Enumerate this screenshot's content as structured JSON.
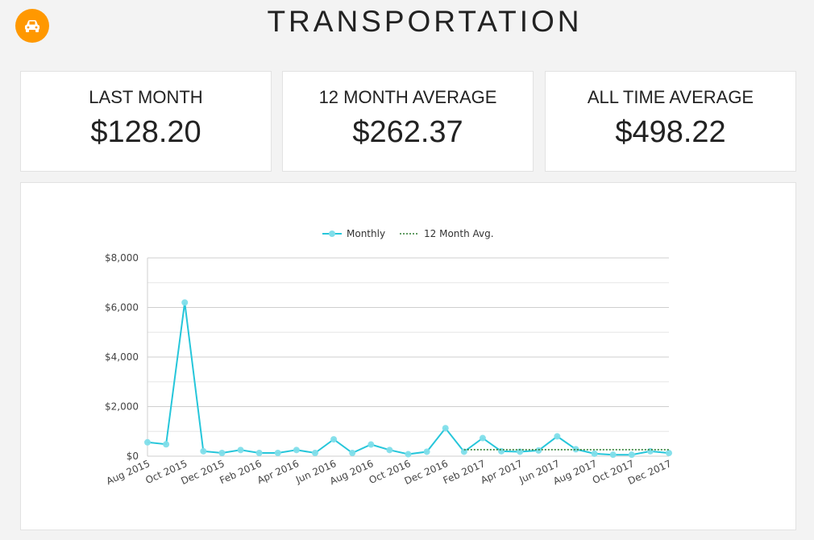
{
  "header": {
    "title": "TRANSPORTATION",
    "icon": "car-icon",
    "icon_color": "#ff9800"
  },
  "stats": [
    {
      "label": "LAST MONTH",
      "value": "$128.20"
    },
    {
      "label": "12 MONTH AVERAGE",
      "value": "$262.37"
    },
    {
      "label": "ALL TIME AVERAGE",
      "value": "$498.22"
    }
  ],
  "chart_data": {
    "type": "line",
    "x": [
      "2015-08",
      "2015-09",
      "2015-10",
      "2015-11",
      "2015-12",
      "2016-01",
      "2016-02",
      "2016-03",
      "2016-04",
      "2016-05",
      "2016-06",
      "2016-07",
      "2016-08",
      "2016-09",
      "2016-10",
      "2016-11",
      "2016-12",
      "2017-01",
      "2017-02",
      "2017-03",
      "2017-04",
      "2017-05",
      "2017-06",
      "2017-07",
      "2017-08",
      "2017-09",
      "2017-10",
      "2017-11",
      "2017-12"
    ],
    "x_tick_labels": [
      "Aug 2015",
      "Oct 2015",
      "Dec 2015",
      "Feb 2016",
      "Apr 2016",
      "Jun 2016",
      "Aug 2016",
      "Oct 2016",
      "Dec 2016",
      "Feb 2017",
      "Apr 2017",
      "Jun 2017",
      "Aug 2017",
      "Oct 2017",
      "Dec 2017"
    ],
    "series": [
      {
        "name": "Monthly",
        "color": "#26c6da",
        "style": "solid",
        "values": [
          560,
          480,
          6200,
          200,
          130,
          250,
          130,
          130,
          250,
          130,
          680,
          130,
          470,
          250,
          80,
          180,
          1130,
          180,
          730,
          200,
          180,
          230,
          800,
          280,
          100,
          60,
          60,
          200,
          128
        ]
      },
      {
        "name": "12 Month Avg.",
        "color": "#2e7d32",
        "style": "dotted",
        "values": [
          null,
          null,
          null,
          null,
          null,
          null,
          null,
          null,
          null,
          null,
          null,
          null,
          null,
          null,
          null,
          null,
          null,
          260,
          262,
          262,
          262,
          262,
          262,
          262,
          262,
          262,
          262,
          262,
          262
        ]
      }
    ],
    "ylim": [
      0,
      8000
    ],
    "y_ticks": [
      "$0",
      "$2,000",
      "$4,000",
      "$6,000",
      "$8,000"
    ],
    "y_tick_values": [
      0,
      2000,
      4000,
      6000,
      8000
    ],
    "grid": true,
    "legend": "top-center",
    "title": "",
    "xlabel": "",
    "ylabel": ""
  }
}
